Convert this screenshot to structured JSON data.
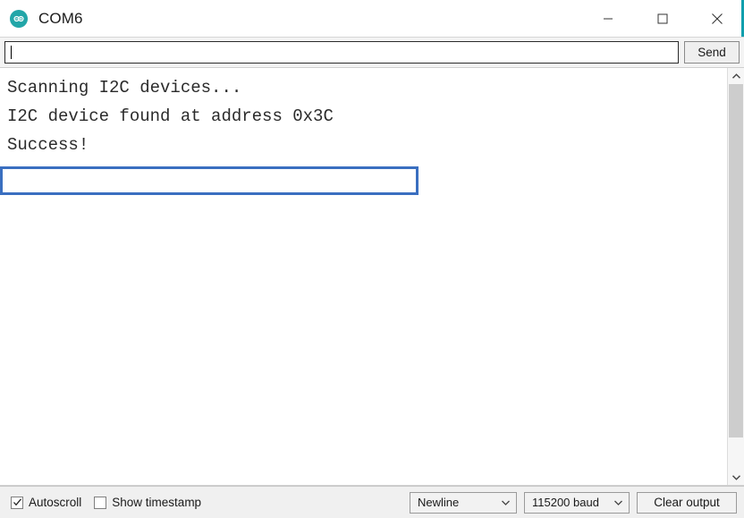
{
  "window": {
    "title": "COM6",
    "app_icon": "arduino-infinity-icon",
    "accent_color": "#0f9fad"
  },
  "window_controls": {
    "minimize": "minimize-icon",
    "maximize": "maximize-icon",
    "close": "close-icon"
  },
  "send_row": {
    "input_value": "",
    "input_placeholder": "",
    "send_label": "Send"
  },
  "console": {
    "lines": [
      {
        "text": "Scanning I2C devices...",
        "highlighted": false
      },
      {
        "text": "I2C device found at address 0x3C",
        "highlighted": true
      },
      {
        "text": "Success!",
        "highlighted": false
      }
    ],
    "highlight_color": "#3a6fc0"
  },
  "scrollbar": {
    "up_icon": "chevron-up-icon",
    "down_icon": "chevron-down-icon"
  },
  "status_bar": {
    "autoscroll": {
      "label": "Autoscroll",
      "checked": true
    },
    "show_timestamp": {
      "label": "Show timestamp",
      "checked": false
    },
    "line_ending": {
      "value": "Newline",
      "caret_icon": "chevron-down-icon"
    },
    "baud_rate": {
      "value": "115200 baud",
      "caret_icon": "chevron-down-icon"
    },
    "clear_output_label": "Clear output"
  }
}
